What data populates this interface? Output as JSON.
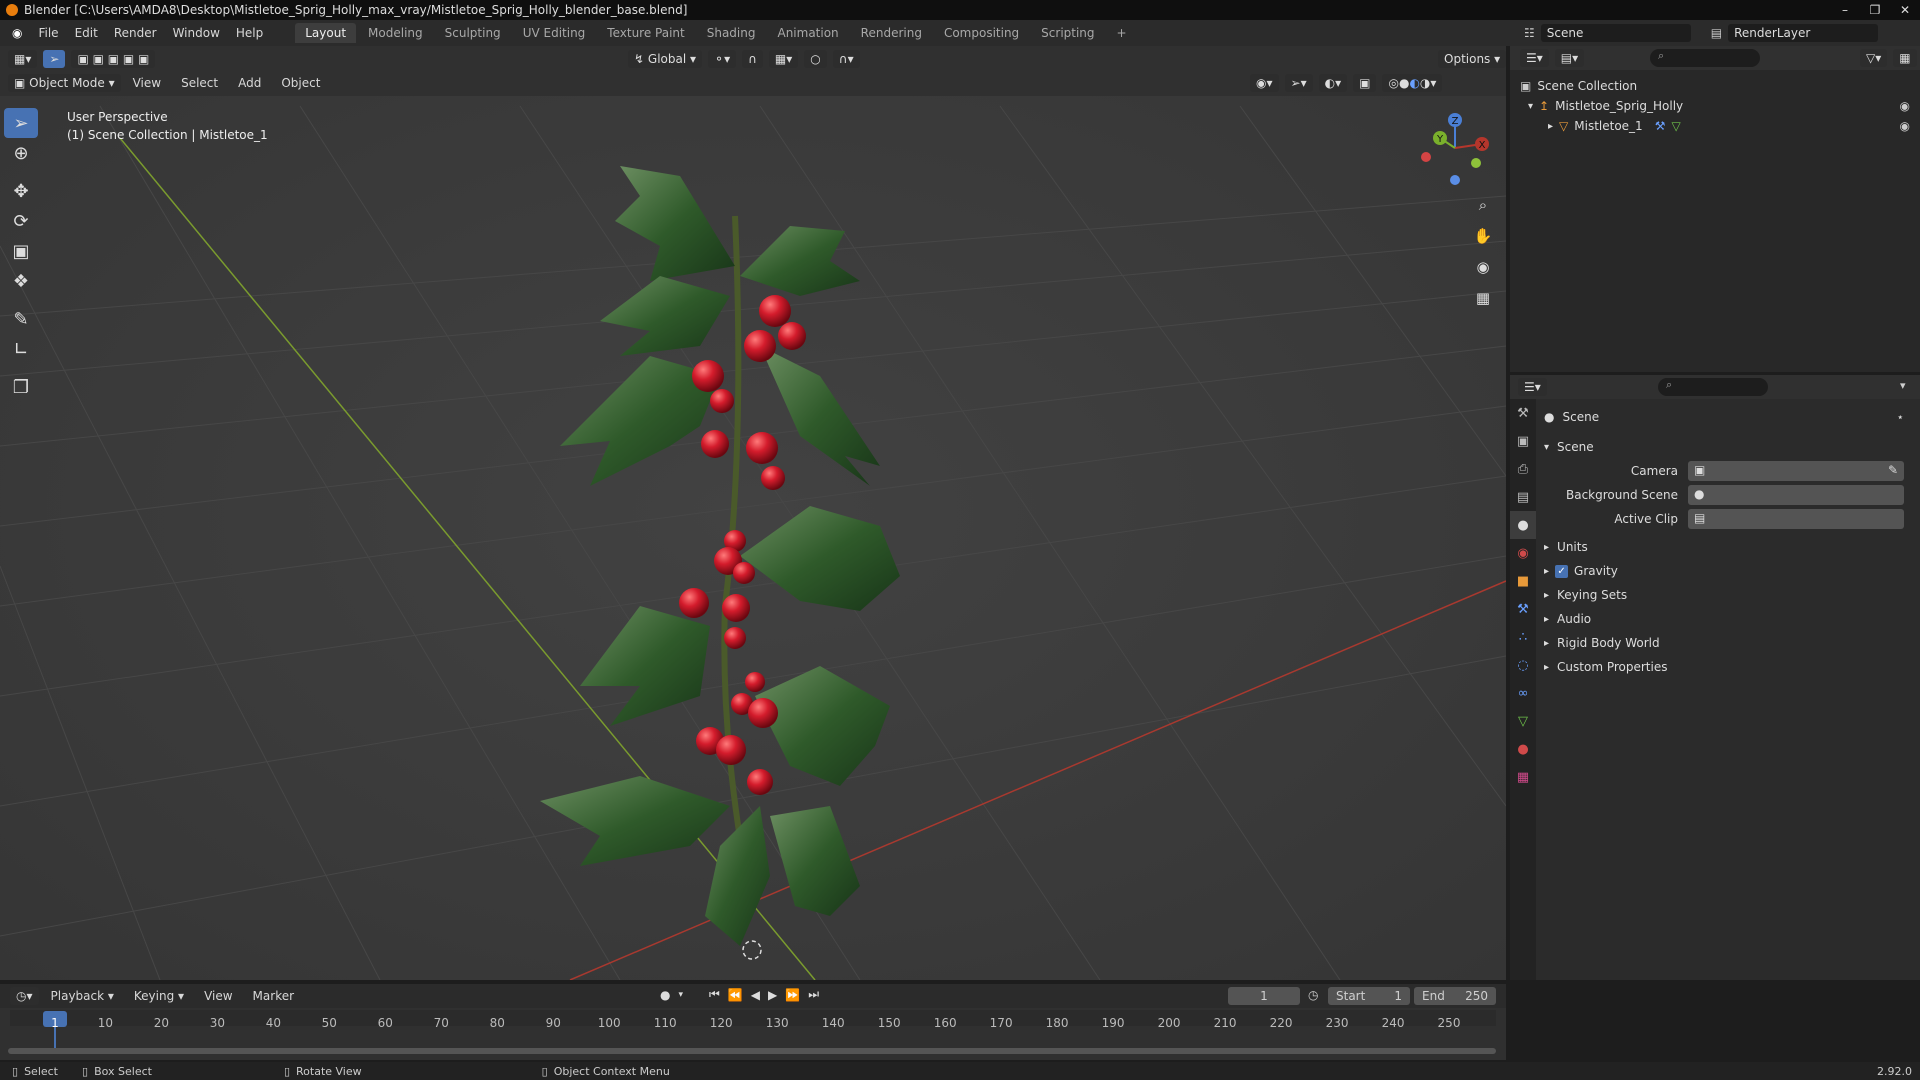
{
  "window": {
    "title": "Blender [C:\\Users\\AMDA8\\Desktop\\Mistletoe_Sprig_Holly_max_vray/Mistletoe_Sprig_Holly_blender_base.blend]"
  },
  "menu": [
    "File",
    "Edit",
    "Render",
    "Window",
    "Help"
  ],
  "workspaces": [
    "Layout",
    "Modeling",
    "Sculpting",
    "UV Editing",
    "Texture Paint",
    "Shading",
    "Animation",
    "Rendering",
    "Compositing",
    "Scripting"
  ],
  "active_workspace": "Layout",
  "scene_selector": {
    "scene": "Scene",
    "layer": "RenderLayer"
  },
  "viewport": {
    "mode": "Object Mode",
    "menus": [
      "View",
      "Select",
      "Add",
      "Object"
    ],
    "orientation": "Global",
    "options_label": "Options",
    "overlay_line1": "User Perspective",
    "overlay_line2": "(1) Scene Collection | Mistletoe_1",
    "gizmo": {
      "x": "X",
      "y": "Y",
      "z": "Z"
    }
  },
  "outliner": {
    "root": "Scene Collection",
    "collection": "Mistletoe_Sprig_Holly",
    "object": "Mistletoe_1"
  },
  "properties": {
    "header": "Scene",
    "section": "Scene",
    "fields": [
      {
        "label": "Camera"
      },
      {
        "label": "Background Scene"
      },
      {
        "label": "Active Clip"
      }
    ],
    "panels": [
      "Units",
      "Gravity",
      "Keying Sets",
      "Audio",
      "Rigid Body World",
      "Custom Properties"
    ],
    "gravity_checked": true
  },
  "timeline": {
    "menus": [
      "Playback",
      "Keying",
      "View",
      "Marker"
    ],
    "current_frame": "1",
    "start_label": "Start",
    "start": "1",
    "end_label": "End",
    "end": "250",
    "ruler": [
      "1",
      "10",
      "20",
      "30",
      "40",
      "50",
      "60",
      "70",
      "80",
      "90",
      "100",
      "110",
      "120",
      "130",
      "140",
      "150",
      "160",
      "170",
      "180",
      "190",
      "200",
      "210",
      "220",
      "230",
      "240",
      "250"
    ]
  },
  "statusbar": {
    "select": "Select",
    "box_select": "Box Select",
    "rotate": "Rotate View",
    "context": "Object Context Menu",
    "version": "2.92.0"
  },
  "colors": {
    "accent": "#4772b3",
    "x_axis": "#b5362c",
    "y_axis": "#7ab02c",
    "leaf": "#2f5a2a",
    "berry": "#c8182a"
  }
}
